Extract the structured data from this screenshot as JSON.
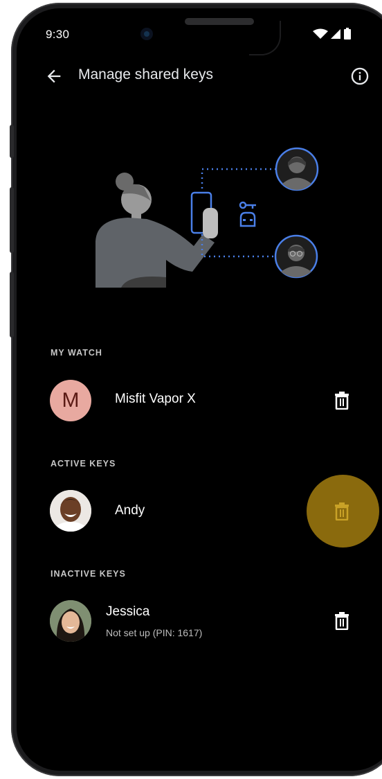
{
  "status_bar": {
    "time": "9:30"
  },
  "app_bar": {
    "title": "Manage shared keys"
  },
  "sections": {
    "my_watch": {
      "label": "MY WATCH",
      "item": {
        "avatar_letter": "M",
        "name": "Misfit Vapor X"
      }
    },
    "active_keys": {
      "label": "ACTIVE KEYS",
      "item": {
        "name": "Andy"
      }
    },
    "inactive_keys": {
      "label": "INACTIVE KEYS",
      "item": {
        "name": "Jessica",
        "subtitle": "Not set up (PIN: 1617)"
      }
    }
  },
  "colors": {
    "accent_blue": "#4a7fe8",
    "avatar_pink": "#e8a9a0",
    "ripple_gold": "#8a6a0d",
    "illustration_gray": "#5f6368"
  },
  "icons": [
    "back-arrow-icon",
    "info-icon",
    "wifi-icon",
    "signal-icon",
    "battery-icon",
    "trash-icon",
    "car-key-icon"
  ]
}
